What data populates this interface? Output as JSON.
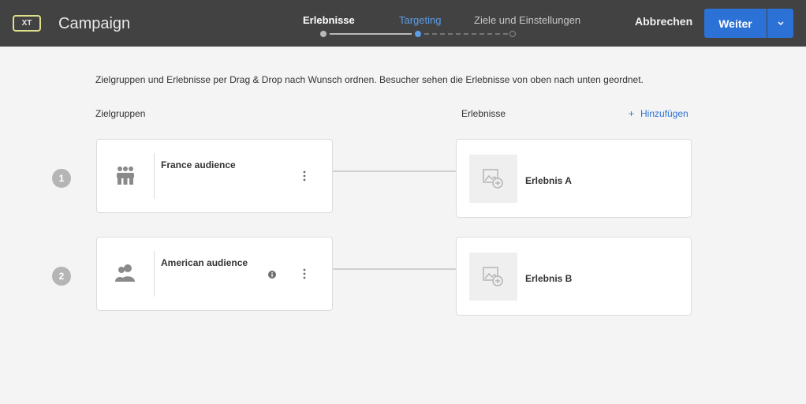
{
  "header": {
    "badge": "XT",
    "title": "Campaign",
    "steps": [
      {
        "label": "Erlebnisse",
        "state": "done"
      },
      {
        "label": "Targeting",
        "state": "active"
      },
      {
        "label": "Ziele und Einstellungen",
        "state": "todo"
      }
    ],
    "cancel_label": "Abbrechen",
    "next_label": "Weiter"
  },
  "main": {
    "instructions": "Zielgruppen und Erlebnisse per Drag & Drop nach Wunsch ordnen. Besucher sehen die Erlebnisse von oben nach unten geordnet.",
    "audiences_label": "Zielgruppen",
    "experiences_label": "Erlebnisse",
    "add_label": "Hinzufügen",
    "rows": [
      {
        "number": "1",
        "audience": "France audience",
        "audience_icon": "group-icon",
        "experience": "Erlebnis A"
      },
      {
        "number": "2",
        "audience": "American audience",
        "audience_icon": "users-icon",
        "experience": "Erlebnis B"
      }
    ]
  },
  "colors": {
    "header_bg": "#424242",
    "accent": "#2c71d6",
    "active_step": "#5a9ee8"
  }
}
